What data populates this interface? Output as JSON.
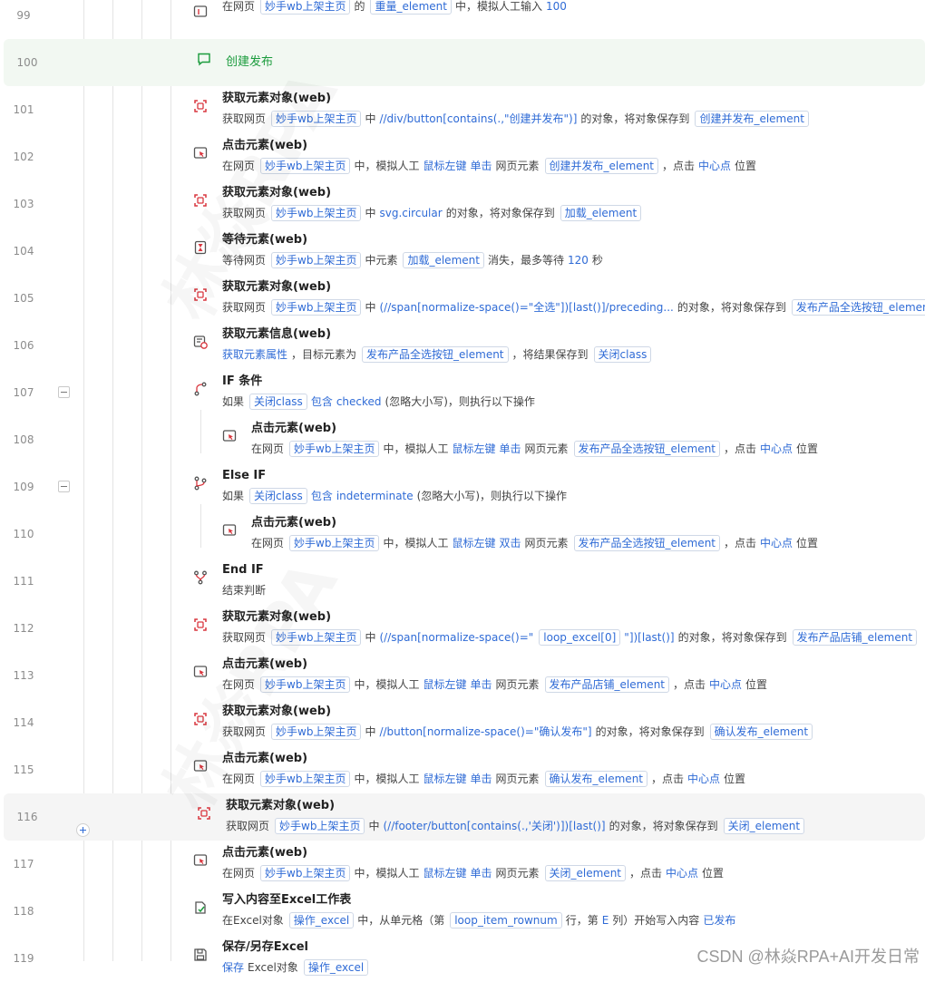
{
  "rows": [
    {
      "num": "99",
      "type": "input",
      "title": "",
      "desc": [
        [
          "t",
          "在网页"
        ],
        [
          "g",
          "妙手wb上架主页"
        ],
        [
          "t",
          "的"
        ],
        [
          "g",
          "重量_element"
        ],
        [
          "t",
          "中，模拟人工输入"
        ],
        [
          "k",
          "100"
        ]
      ]
    },
    {
      "num": "100",
      "type": "comment",
      "title": "创建发布",
      "desc": []
    },
    {
      "num": "101",
      "type": "get",
      "title": "获取元素对象(web)",
      "desc": [
        [
          "t",
          "获取网页"
        ],
        [
          "g",
          "妙手wb上架主页"
        ],
        [
          "t",
          "中"
        ],
        [
          "k",
          "//div/button[contains(.,\"创建并发布\")]"
        ],
        [
          "t",
          "的对象，将对象保存到"
        ],
        [
          "g",
          "创建并发布_element"
        ]
      ]
    },
    {
      "num": "102",
      "type": "click",
      "title": "点击元素(web)",
      "desc": [
        [
          "t",
          "在网页"
        ],
        [
          "g",
          "妙手wb上架主页"
        ],
        [
          "t",
          "中，模拟人工"
        ],
        [
          "k",
          "鼠标左键"
        ],
        [
          "k",
          "单击"
        ],
        [
          "t",
          "网页元素"
        ],
        [
          "g",
          "创建并发布_element"
        ],
        [
          "t",
          "，点击"
        ],
        [
          "k",
          "中心点"
        ],
        [
          "t",
          "位置"
        ]
      ]
    },
    {
      "num": "103",
      "type": "get",
      "title": "获取元素对象(web)",
      "desc": [
        [
          "t",
          "获取网页"
        ],
        [
          "g",
          "妙手wb上架主页"
        ],
        [
          "t",
          "中"
        ],
        [
          "k",
          "svg.circular"
        ],
        [
          "t",
          "的对象，将对象保存到"
        ],
        [
          "g",
          "加载_element"
        ]
      ]
    },
    {
      "num": "104",
      "type": "wait",
      "title": "等待元素(web)",
      "desc": [
        [
          "t",
          "等待网页"
        ],
        [
          "g",
          "妙手wb上架主页"
        ],
        [
          "t",
          "中元素"
        ],
        [
          "g",
          "加载_element"
        ],
        [
          "t",
          "消失，最多等待"
        ],
        [
          "k",
          "120"
        ],
        [
          "t",
          "秒"
        ]
      ]
    },
    {
      "num": "105",
      "type": "get",
      "title": "获取元素对象(web)",
      "desc": [
        [
          "t",
          "获取网页"
        ],
        [
          "g",
          "妙手wb上架主页"
        ],
        [
          "t",
          "中"
        ],
        [
          "k",
          "(//span[normalize-space()=\"全选\"])[last()]/preceding..."
        ],
        [
          "t",
          "的对象，将对象保存到"
        ],
        [
          "g",
          "发布产品全选按钮_element"
        ]
      ]
    },
    {
      "num": "106",
      "type": "info",
      "title": "获取元素信息(web)",
      "desc": [
        [
          "k",
          "获取元素属性"
        ],
        [
          "t",
          "，目标元素为"
        ],
        [
          "g",
          "发布产品全选按钮_element"
        ],
        [
          "t",
          "，将结果保存到"
        ],
        [
          "g",
          "关闭class"
        ]
      ]
    },
    {
      "num": "107",
      "type": "if",
      "title": "IF 条件",
      "desc": [
        [
          "t",
          "如果"
        ],
        [
          "g",
          "关闭class"
        ],
        [
          "k",
          "包含"
        ],
        [
          "k",
          "checked"
        ],
        [
          "t",
          "(忽略大小写)，则执行以下操作"
        ]
      ]
    },
    {
      "num": "108",
      "type": "click",
      "title": "点击元素(web)",
      "desc": [
        [
          "t",
          "在网页"
        ],
        [
          "g",
          "妙手wb上架主页"
        ],
        [
          "t",
          "中，模拟人工"
        ],
        [
          "k",
          "鼠标左键"
        ],
        [
          "k",
          "单击"
        ],
        [
          "t",
          "网页元素"
        ],
        [
          "g",
          "发布产品全选按钮_element"
        ],
        [
          "t",
          "，点击"
        ],
        [
          "k",
          "中心点"
        ],
        [
          "t",
          "位置"
        ]
      ]
    },
    {
      "num": "109",
      "type": "elseif",
      "title": "Else IF",
      "desc": [
        [
          "t",
          "如果"
        ],
        [
          "g",
          "关闭class"
        ],
        [
          "k",
          "包含"
        ],
        [
          "k",
          "indeterminate"
        ],
        [
          "t",
          "(忽略大小写)，则执行以下操作"
        ]
      ]
    },
    {
      "num": "110",
      "type": "click",
      "title": "点击元素(web)",
      "desc": [
        [
          "t",
          "在网页"
        ],
        [
          "g",
          "妙手wb上架主页"
        ],
        [
          "t",
          "中，模拟人工"
        ],
        [
          "k",
          "鼠标左键"
        ],
        [
          "k",
          "双击"
        ],
        [
          "t",
          "网页元素"
        ],
        [
          "g",
          "发布产品全选按钮_element"
        ],
        [
          "t",
          "，点击"
        ],
        [
          "k",
          "中心点"
        ],
        [
          "t",
          "位置"
        ]
      ]
    },
    {
      "num": "111",
      "type": "endif",
      "title": "End IF",
      "desc": [
        [
          "t",
          "结束判断"
        ]
      ]
    },
    {
      "num": "112",
      "type": "get",
      "title": "获取元素对象(web)",
      "desc": [
        [
          "t",
          "获取网页"
        ],
        [
          "g",
          "妙手wb上架主页"
        ],
        [
          "t",
          "中"
        ],
        [
          "k",
          "(//span[normalize-space()=\""
        ],
        [
          "g",
          "loop_excel[0]"
        ],
        [
          "k",
          "\"])[last()]"
        ],
        [
          "t",
          "的对象，将对象保存到"
        ],
        [
          "g",
          "发布产品店铺_element"
        ]
      ]
    },
    {
      "num": "113",
      "type": "click",
      "title": "点击元素(web)",
      "desc": [
        [
          "t",
          "在网页"
        ],
        [
          "g",
          "妙手wb上架主页"
        ],
        [
          "t",
          "中，模拟人工"
        ],
        [
          "k",
          "鼠标左键"
        ],
        [
          "k",
          "单击"
        ],
        [
          "t",
          "网页元素"
        ],
        [
          "g",
          "发布产品店铺_element"
        ],
        [
          "t",
          "，点击"
        ],
        [
          "k",
          "中心点"
        ],
        [
          "t",
          "位置"
        ]
      ]
    },
    {
      "num": "114",
      "type": "get",
      "title": "获取元素对象(web)",
      "desc": [
        [
          "t",
          "获取网页"
        ],
        [
          "g",
          "妙手wb上架主页"
        ],
        [
          "t",
          "中"
        ],
        [
          "k",
          "//button[normalize-space()=\"确认发布\"]"
        ],
        [
          "t",
          "的对象，将对象保存到"
        ],
        [
          "g",
          "确认发布_element"
        ]
      ]
    },
    {
      "num": "115",
      "type": "click",
      "title": "点击元素(web)",
      "desc": [
        [
          "t",
          "在网页"
        ],
        [
          "g",
          "妙手wb上架主页"
        ],
        [
          "t",
          "中，模拟人工"
        ],
        [
          "k",
          "鼠标左键"
        ],
        [
          "k",
          "单击"
        ],
        [
          "t",
          "网页元素"
        ],
        [
          "g",
          "确认发布_element"
        ],
        [
          "t",
          "，点击"
        ],
        [
          "k",
          "中心点"
        ],
        [
          "t",
          "位置"
        ]
      ]
    },
    {
      "num": "116",
      "type": "get",
      "title": "获取元素对象(web)",
      "desc": [
        [
          "t",
          "获取网页"
        ],
        [
          "g",
          "妙手wb上架主页"
        ],
        [
          "t",
          "中"
        ],
        [
          "k",
          "(//footer/button[contains(.,'关闭')])[last()]"
        ],
        [
          "t",
          "的对象，将对象保存到"
        ],
        [
          "g",
          "关闭_element"
        ]
      ]
    },
    {
      "num": "117",
      "type": "click",
      "title": "点击元素(web)",
      "desc": [
        [
          "t",
          "在网页"
        ],
        [
          "g",
          "妙手wb上架主页"
        ],
        [
          "t",
          "中，模拟人工"
        ],
        [
          "k",
          "鼠标左键"
        ],
        [
          "k",
          "单击"
        ],
        [
          "t",
          "网页元素"
        ],
        [
          "g",
          "关闭_element"
        ],
        [
          "t",
          "，点击"
        ],
        [
          "k",
          "中心点"
        ],
        [
          "t",
          "位置"
        ]
      ]
    },
    {
      "num": "118",
      "type": "excel",
      "title": "写入内容至Excel工作表",
      "desc": [
        [
          "t",
          "在Excel对象"
        ],
        [
          "g",
          "操作_excel"
        ],
        [
          "t",
          "中，从单元格（第"
        ],
        [
          "g",
          "loop_item_rownum"
        ],
        [
          "t",
          "行，第"
        ],
        [
          "k",
          "E"
        ],
        [
          "t",
          "列）开始写入内容"
        ],
        [
          "k",
          "已发布"
        ]
      ]
    },
    {
      "num": "119",
      "type": "save",
      "title": "保存/另存Excel",
      "desc": [
        [
          "k",
          "保存"
        ],
        [
          "t",
          "Excel对象"
        ],
        [
          "g",
          "操作_excel"
        ]
      ]
    }
  ],
  "watermark": "CSDN @林焱RPA+AI开发日常",
  "bg_watermark": "林焱RPA",
  "colors": {
    "accent": "#2f6bd6",
    "icon_red": "#d9363e",
    "comment_green": "#1a9b3c"
  }
}
